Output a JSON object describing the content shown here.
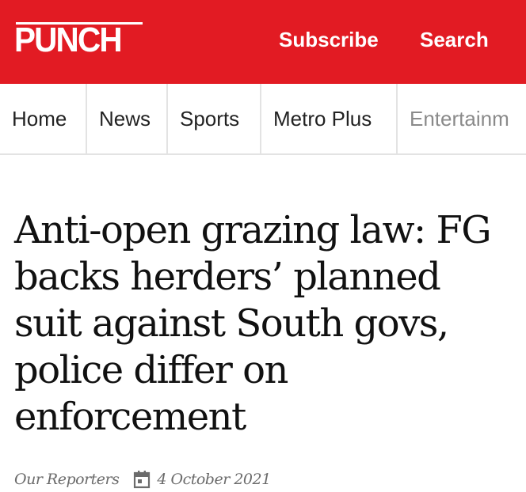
{
  "header": {
    "logo_text": "PUNCH",
    "subscribe_label": "Subscribe",
    "search_label": "Search",
    "brand_color": "#e21b23"
  },
  "nav": {
    "items": [
      {
        "label": "Home"
      },
      {
        "label": "News"
      },
      {
        "label": "Sports"
      },
      {
        "label": "Metro Plus"
      },
      {
        "label": "Entertainm"
      }
    ]
  },
  "article": {
    "headline": "Anti-open grazing law: FG backs herders’ planned suit against South govs, police differ on enforcement",
    "author": "Our Reporters",
    "date": "4 October 2021",
    "date_icon": "calendar-icon"
  }
}
